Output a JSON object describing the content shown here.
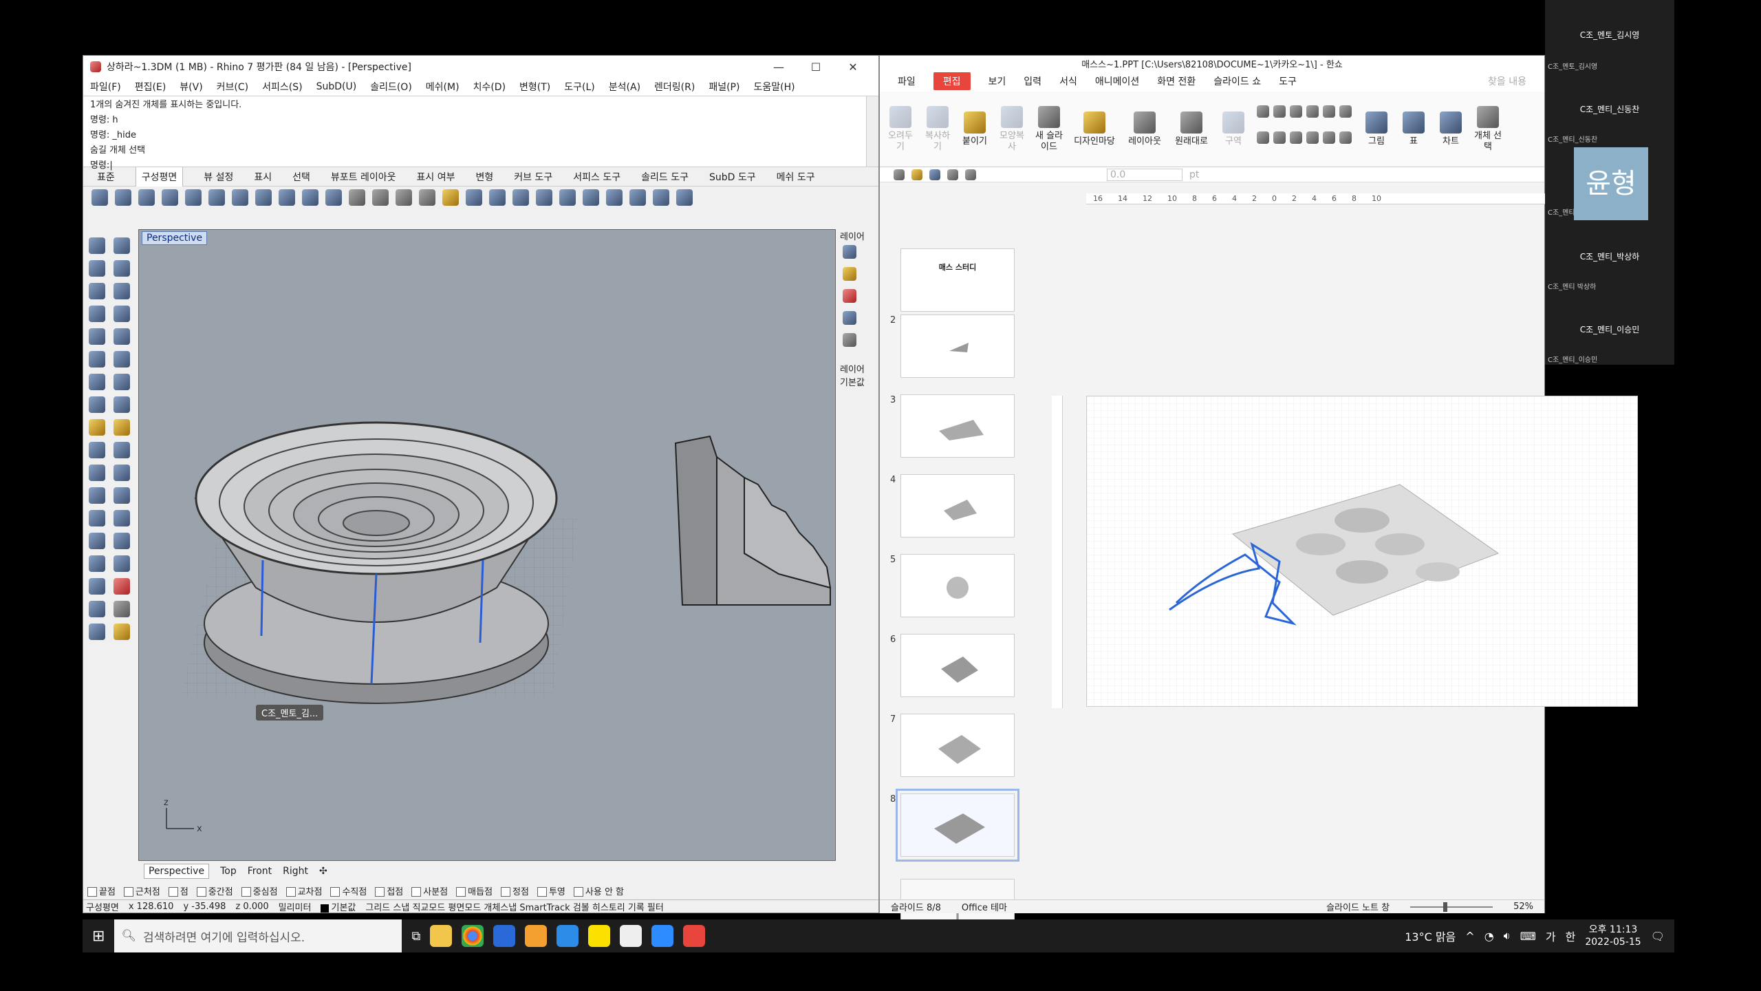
{
  "rhino": {
    "title": "상하라~1.3DM (1 MB) - Rhino 7 평가판 (84 일 남음) - [Perspective]",
    "menu": [
      "파일(F)",
      "편집(E)",
      "뷰(V)",
      "커브(C)",
      "서피스(S)",
      "SubD(U)",
      "솔리드(O)",
      "메쉬(M)",
      "치수(D)",
      "변형(T)",
      "도구(L)",
      "분석(A)",
      "렌더링(R)",
      "패널(P)",
      "도움말(H)"
    ],
    "cmdlines": [
      "1개의 숨겨진 개체를 표시하는 중입니다.",
      "명령: h",
      "명령: _hide",
      "숨길 개체 선택"
    ],
    "cmdprompt": "명령:",
    "tabs": [
      "표준",
      "구성평면",
      "뷰 설정",
      "표시",
      "선택",
      "뷰포트 레이아웃",
      "표시 여부",
      "변형",
      "커브 도구",
      "서피스 도구",
      "솔리드 도구",
      "SubD 도구",
      "메쉬 도구"
    ],
    "viewport_label": "Perspective",
    "tooltip": "C조_멘토_김...",
    "panel": {
      "layer": "레이어",
      "layer2": "레이어",
      "default": "기본값"
    },
    "vptabs": [
      "Perspective",
      "Top",
      "Front",
      "Right"
    ],
    "osnap": [
      "끝점",
      "근처점",
      "점",
      "중간점",
      "중심점",
      "교차점",
      "수직점",
      "접점",
      "사분점",
      "매듭점",
      "정점",
      "투영",
      "사용 안 함"
    ],
    "status": {
      "cplane": "구성평면",
      "x": "x 128.610",
      "y": "y -35.498",
      "z": "z 0.000",
      "unit": "밀리미터",
      "layer": "기본값",
      "modes": "그리드 스냅 직교모드 평면모드 개체스냅 SmartTrack 검볼 히스토리 기록 필터"
    }
  },
  "hancom": {
    "title": "매스스~1.PPT [C:\\Users\\82108\\DOCUME~1\\카카오~1\\] - 한쇼",
    "menu": [
      "파일",
      "편집",
      "보기",
      "입력",
      "서식",
      "애니메이션",
      "화면 전환",
      "슬라이드 쇼",
      "도구"
    ],
    "menu_right": "찾을 내용",
    "ribbon": [
      {
        "label": "오려두기",
        "dis": true
      },
      {
        "label": "복사하기",
        "dis": true
      },
      {
        "label": "붙이기",
        "dis": false
      },
      {
        "label": "모양복사",
        "dis": true
      },
      {
        "label": "새 슬라이드",
        "dis": false
      },
      {
        "label": "디자인마당",
        "dis": false
      },
      {
        "label": "레이아웃",
        "dis": false
      },
      {
        "label": "원래대로",
        "dis": false
      },
      {
        "label": "구역",
        "dis": true
      },
      {
        "label": "그림",
        "dis": false
      },
      {
        "label": "표",
        "dis": false
      },
      {
        "label": "차트",
        "dis": false
      },
      {
        "label": "개체 선택",
        "dis": false
      }
    ],
    "font_size": "0.0",
    "font_unit": "pt",
    "ruler": [
      "16",
      "14",
      "12",
      "10",
      "8",
      "6",
      "4",
      "2",
      "0",
      "2",
      "4",
      "6",
      "8",
      "10"
    ],
    "thumbs": [
      {
        "num": "",
        "text": "매스 스터디"
      },
      {
        "num": "2",
        "text": ""
      },
      {
        "num": "3",
        "text": ""
      },
      {
        "num": "4",
        "text": ""
      },
      {
        "num": "5",
        "text": ""
      },
      {
        "num": "6",
        "text": ""
      },
      {
        "num": "7",
        "text": ""
      },
      {
        "num": "8",
        "text": ""
      }
    ],
    "add_slide": "+",
    "status": {
      "slide": "슬라이드 8/8",
      "theme": "Office 테마",
      "notes": "슬라이드 노트 창",
      "zoom": "52%"
    }
  },
  "participants": [
    {
      "name": "C조_멘토_김시영",
      "sub": "C조_멘토_김시영"
    },
    {
      "name": "C조_멘티_신동찬",
      "sub": "C조_멘티_신동찬"
    },
    {
      "name": "",
      "sub": "C조_멘티_김윤형"
    },
    {
      "name": "C조_멘티_박상하",
      "sub": "C조_멘티 박상하"
    },
    {
      "name": "C조_멘티_이승민",
      "sub": "C조_멘티_이승민"
    }
  ],
  "avatar": "윤형",
  "taskbar": {
    "search": "검색하려면 여기에 입력하십시오.",
    "weather": "13°C 맑음",
    "ime1": "가",
    "ime2": "한",
    "time": "오후 11:13",
    "date": "2022-05-15"
  }
}
